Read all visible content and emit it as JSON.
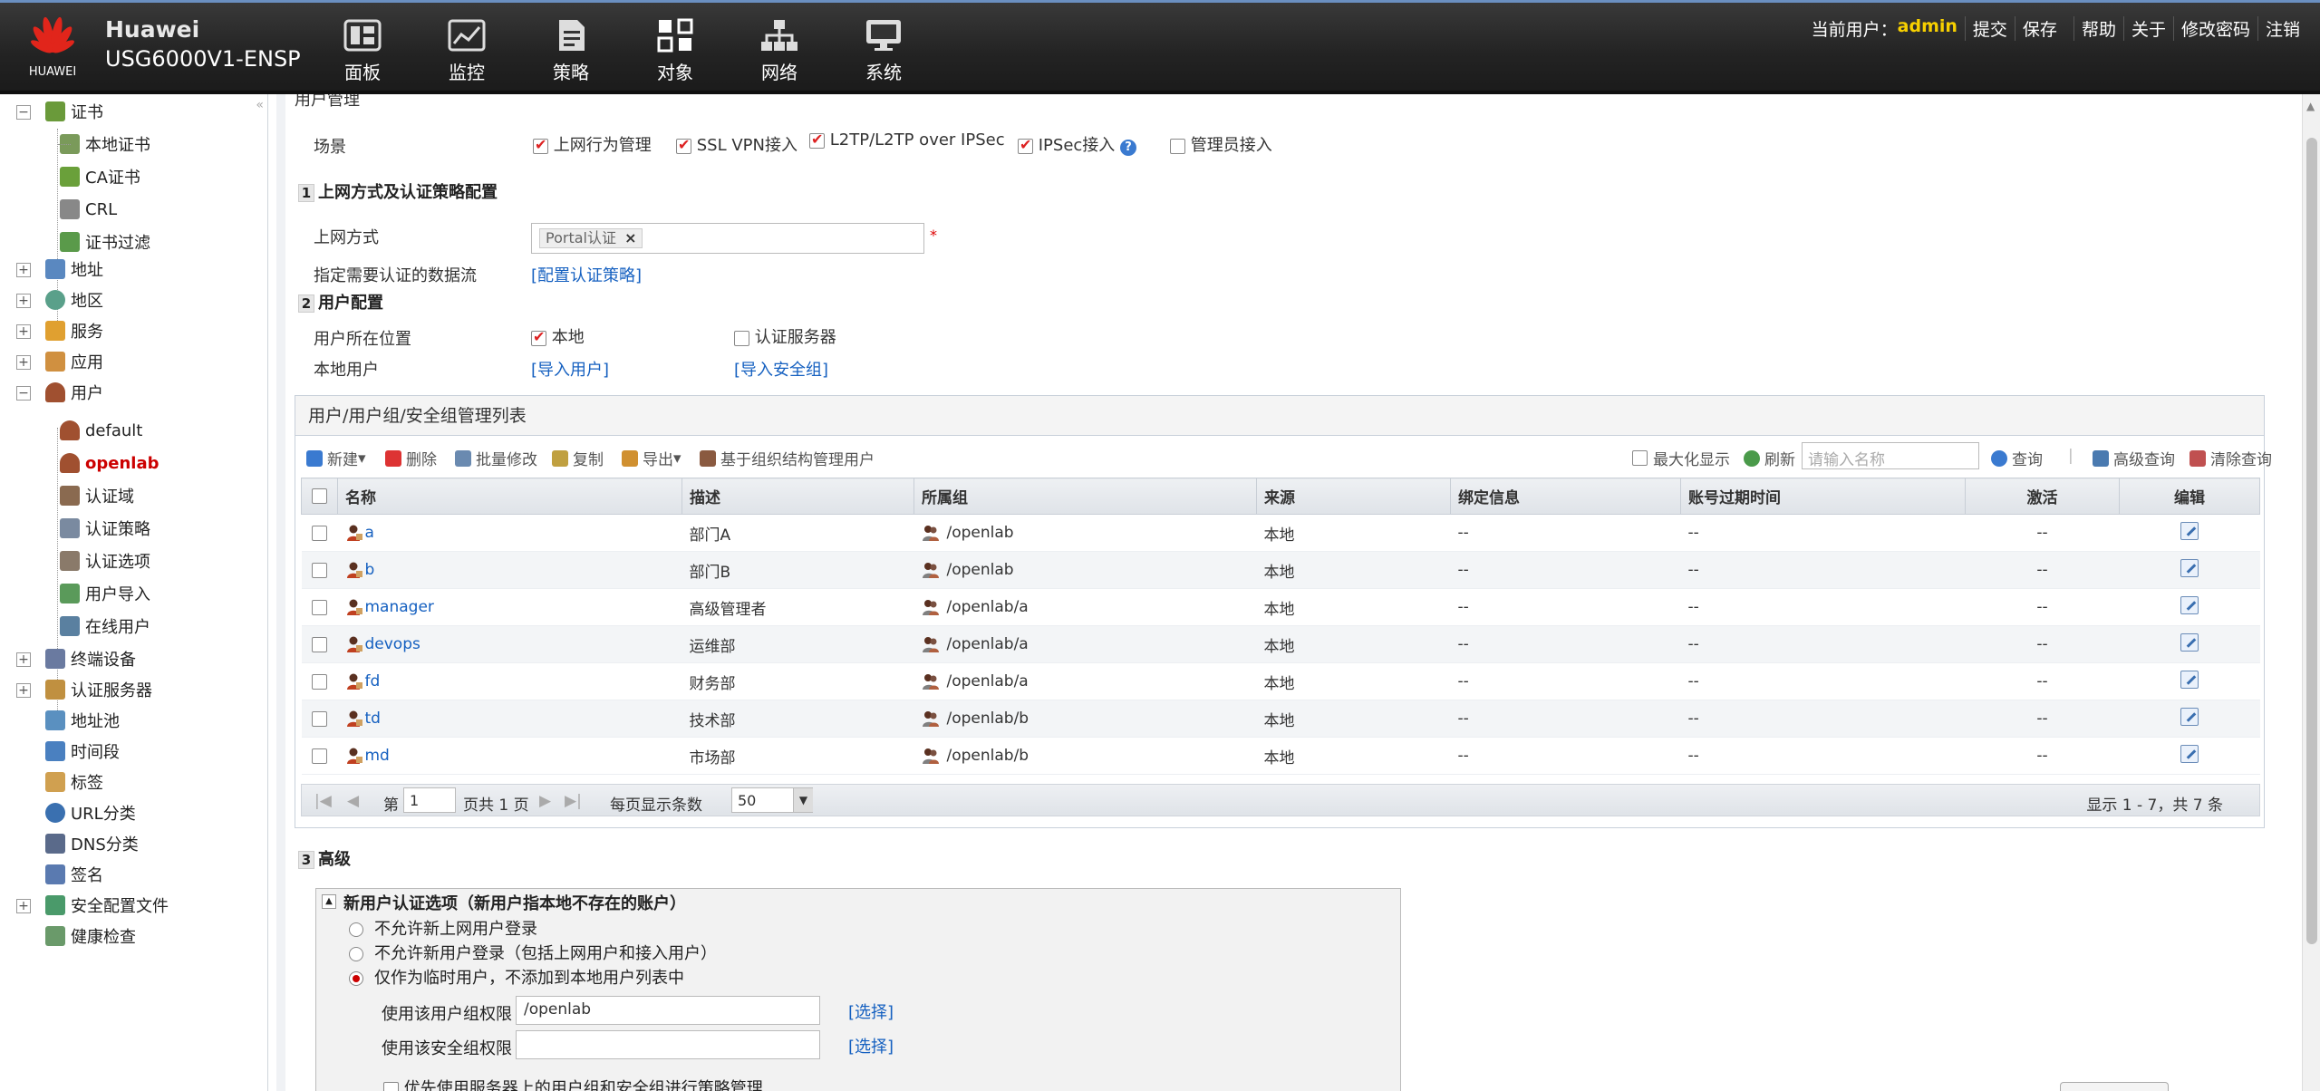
{
  "header": {
    "logo_text": "HUAWEI",
    "brand": "Huawei",
    "model": "USG6000V1-ENSP",
    "nav": [
      {
        "label": "面板",
        "icon": "dashboard-icon"
      },
      {
        "label": "监控",
        "icon": "monitor-icon"
      },
      {
        "label": "策略",
        "icon": "policy-icon"
      },
      {
        "label": "对象",
        "icon": "object-icon"
      },
      {
        "label": "网络",
        "icon": "network-icon"
      },
      {
        "label": "系统",
        "icon": "system-icon"
      }
    ],
    "current_user_label": "当前用户：",
    "current_user": "admin",
    "links": [
      "提交",
      "保存",
      "帮助",
      "关于",
      "修改密码",
      "注销"
    ]
  },
  "sidebar": {
    "collapse": "«",
    "items": [
      {
        "label": "证书",
        "toggle": "−"
      },
      {
        "label": "本地证书"
      },
      {
        "label": "CA证书"
      },
      {
        "label": "CRL"
      },
      {
        "label": "证书过滤"
      },
      {
        "label": "地址",
        "toggle": "+"
      },
      {
        "label": "地区",
        "toggle": "+"
      },
      {
        "label": "服务",
        "toggle": "+"
      },
      {
        "label": "应用",
        "toggle": "+"
      },
      {
        "label": "用户",
        "toggle": "−"
      },
      {
        "label": "default"
      },
      {
        "label": "openlab"
      },
      {
        "label": "认证域"
      },
      {
        "label": "认证策略"
      },
      {
        "label": "认证选项"
      },
      {
        "label": "用户导入"
      },
      {
        "label": "在线用户"
      },
      {
        "label": "终端设备",
        "toggle": "+"
      },
      {
        "label": "认证服务器",
        "toggle": "+"
      },
      {
        "label": "地址池"
      },
      {
        "label": "时间段"
      },
      {
        "label": "标签"
      },
      {
        "label": "URL分类"
      },
      {
        "label": "DNS分类"
      },
      {
        "label": "签名"
      },
      {
        "label": "安全配置文件",
        "toggle": "+"
      },
      {
        "label": "健康检查"
      }
    ]
  },
  "main": {
    "panel_title": "用户管理",
    "scene_label": "场景",
    "scenes": [
      {
        "label": "上网行为管理",
        "checked": true
      },
      {
        "label": "SSL VPN接入",
        "checked": true
      },
      {
        "label": "L2TP/L2TP over IPSec",
        "checked": true
      },
      {
        "label": "IPSec接入",
        "checked": true
      },
      {
        "label": "管理员接入",
        "checked": false
      }
    ],
    "help": "?",
    "s1": {
      "num": "1",
      "title": "上网方式及认证策略配置",
      "access_label": "上网方式",
      "access_tag": "Portal认证",
      "tag_close": "×",
      "req": "*",
      "flow_label": "指定需要认证的数据流",
      "flow_link": "[配置认证策略]"
    },
    "s2": {
      "num": "2",
      "title": "用户配置",
      "loc_label": "用户所在位置",
      "loc_local": "本地",
      "loc_server": "认证服务器",
      "local_user_label": "本地用户",
      "import_users": "[导入用户]",
      "import_groups": "[导入安全组]"
    },
    "grid": {
      "title": "用户/用户组/安全组管理列表",
      "toolbar": {
        "new": "新建",
        "delete": "删除",
        "batch": "批量修改",
        "copy": "复制",
        "export": "导出",
        "org": "基于组织结构管理用户",
        "maximize": "最大化显示",
        "refresh": "刷新",
        "search_placeholder": "请输入名称",
        "query": "查询",
        "adv_query": "高级查询",
        "clear_query": "清除查询"
      },
      "columns": [
        "名称",
        "描述",
        "所属组",
        "来源",
        "绑定信息",
        "账号过期时间",
        "激活",
        "编辑"
      ],
      "rows": [
        {
          "name": "a",
          "desc": "部门A",
          "group": "/openlab",
          "source": "本地",
          "bind": "--",
          "expire": "--",
          "active": "--"
        },
        {
          "name": "b",
          "desc": "部门B",
          "group": "/openlab",
          "source": "本地",
          "bind": "--",
          "expire": "--",
          "active": "--"
        },
        {
          "name": "manager",
          "desc": "高级管理者",
          "group": "/openlab/a",
          "source": "本地",
          "bind": "--",
          "expire": "--",
          "active": "--"
        },
        {
          "name": "devops",
          "desc": "运维部",
          "group": "/openlab/a",
          "source": "本地",
          "bind": "--",
          "expire": "--",
          "active": "--"
        },
        {
          "name": "fd",
          "desc": "财务部",
          "group": "/openlab/a",
          "source": "本地",
          "bind": "--",
          "expire": "--",
          "active": "--"
        },
        {
          "name": "td",
          "desc": "技术部",
          "group": "/openlab/b",
          "source": "本地",
          "bind": "--",
          "expire": "--",
          "active": "--"
        },
        {
          "name": "md",
          "desc": "市场部",
          "group": "/openlab/b",
          "source": "本地",
          "bind": "--",
          "expire": "--",
          "active": "--"
        }
      ],
      "pager": {
        "page_prefix": "第",
        "page": "1",
        "page_suffix": "页共 1 页",
        "per_page_label": "每页显示条数",
        "per_page": "50",
        "summary": "显示 1 - 7，共 7 条"
      }
    },
    "s3": {
      "num": "3",
      "title": "高级",
      "box_title": "新用户认证选项（新用户指本地不存在的账户）",
      "toggle": "▲",
      "options": [
        {
          "label": "不允许新上网用户登录",
          "selected": false
        },
        {
          "label": "不允许新用户登录（包括上网用户和接入用户）",
          "selected": false
        },
        {
          "label": "仅作为临时用户，不添加到本地用户列表中",
          "selected": true
        }
      ],
      "group_perm_label": "使用该用户组权限",
      "group_perm_value": "/openlab",
      "select_link": "[选择]",
      "sec_perm_label": "使用该安全组权限",
      "sec_perm_value": "",
      "select_link2": "[选择]",
      "prefer_server": "优先使用服务器上的用户组和安全组进行策略管理"
    }
  }
}
